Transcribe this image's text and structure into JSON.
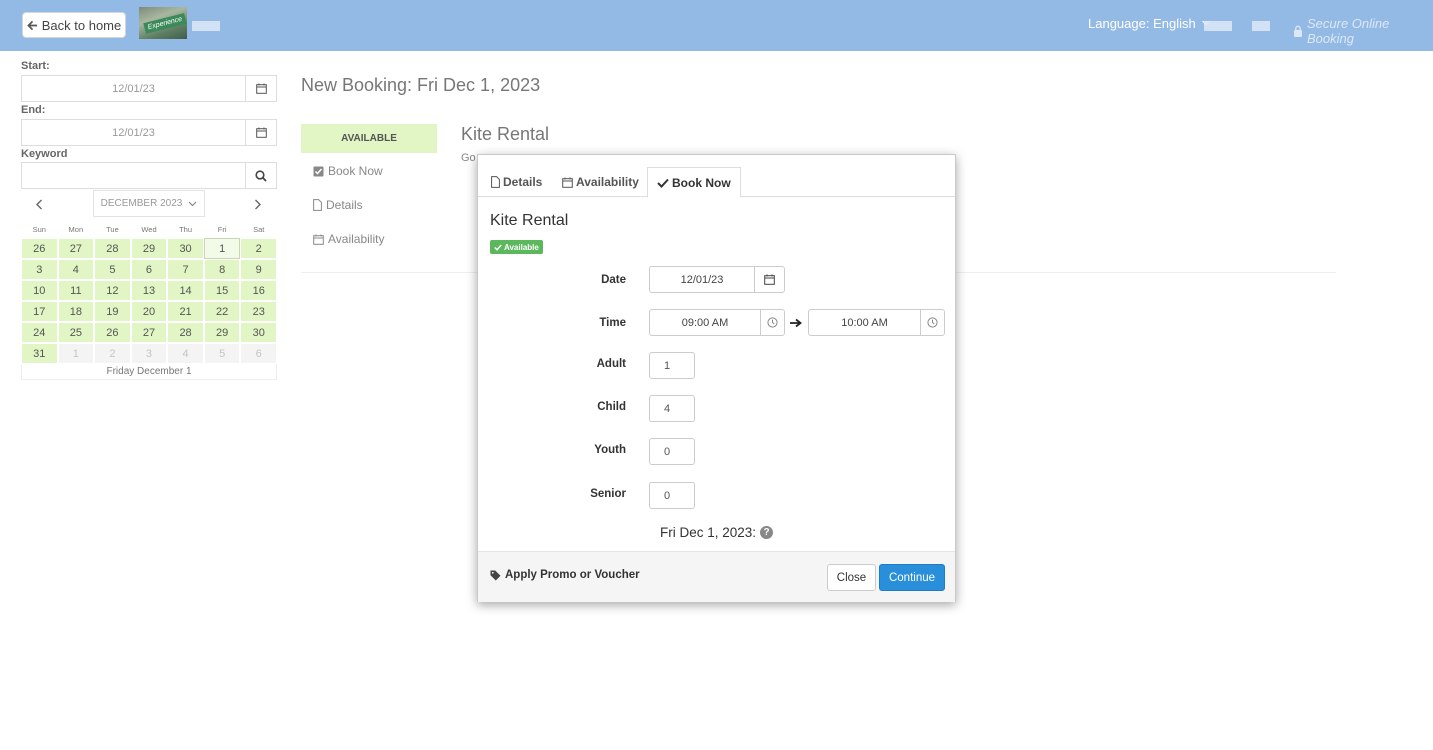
{
  "header": {
    "back_label": "Back to home",
    "logo_text": "Experience",
    "language_label": "Language: English",
    "secure_label": "Secure Online Booking"
  },
  "filters": {
    "start_label": "Start:",
    "start_value": "12/01/23",
    "end_label": "End:",
    "end_value": "12/01/23",
    "keyword_label": "Keyword",
    "keyword_value": ""
  },
  "calendar": {
    "month_label": "DECEMBER 2023",
    "weekdays": [
      "Sun",
      "Mon",
      "Tue",
      "Wed",
      "Thu",
      "Fri",
      "Sat"
    ],
    "days": [
      {
        "d": "26",
        "state": "available"
      },
      {
        "d": "27",
        "state": "available"
      },
      {
        "d": "28",
        "state": "available"
      },
      {
        "d": "29",
        "state": "available"
      },
      {
        "d": "30",
        "state": "available"
      },
      {
        "d": "1",
        "state": "selected"
      },
      {
        "d": "2",
        "state": "available"
      },
      {
        "d": "3",
        "state": "available"
      },
      {
        "d": "4",
        "state": "available"
      },
      {
        "d": "5",
        "state": "available"
      },
      {
        "d": "6",
        "state": "available"
      },
      {
        "d": "7",
        "state": "available"
      },
      {
        "d": "8",
        "state": "available"
      },
      {
        "d": "9",
        "state": "available"
      },
      {
        "d": "10",
        "state": "available"
      },
      {
        "d": "11",
        "state": "available"
      },
      {
        "d": "12",
        "state": "available"
      },
      {
        "d": "13",
        "state": "available"
      },
      {
        "d": "14",
        "state": "available"
      },
      {
        "d": "15",
        "state": "available"
      },
      {
        "d": "16",
        "state": "available"
      },
      {
        "d": "17",
        "state": "available"
      },
      {
        "d": "18",
        "state": "available"
      },
      {
        "d": "19",
        "state": "available"
      },
      {
        "d": "20",
        "state": "available"
      },
      {
        "d": "21",
        "state": "available"
      },
      {
        "d": "22",
        "state": "available"
      },
      {
        "d": "23",
        "state": "available"
      },
      {
        "d": "24",
        "state": "available"
      },
      {
        "d": "25",
        "state": "available"
      },
      {
        "d": "26",
        "state": "available"
      },
      {
        "d": "27",
        "state": "available"
      },
      {
        "d": "28",
        "state": "available"
      },
      {
        "d": "29",
        "state": "available"
      },
      {
        "d": "30",
        "state": "available"
      },
      {
        "d": "31",
        "state": "available"
      },
      {
        "d": "1",
        "state": "other"
      },
      {
        "d": "2",
        "state": "other"
      },
      {
        "d": "3",
        "state": "other"
      },
      {
        "d": "4",
        "state": "other"
      },
      {
        "d": "5",
        "state": "other"
      },
      {
        "d": "6",
        "state": "other"
      }
    ],
    "selected_label": "Friday December 1"
  },
  "main": {
    "page_title": "New Booking: Fri Dec 1, 2023",
    "availability_status": "AVAILABLE",
    "links": {
      "book_now": "Book Now",
      "details": "Details",
      "availability": "Availability"
    },
    "product_title": "Kite Rental",
    "product_desc": "Go"
  },
  "modal": {
    "tabs": {
      "details": "Details",
      "availability": "Availability",
      "book_now": "Book Now"
    },
    "title": "Kite Rental",
    "badge": "Available",
    "date_label": "Date",
    "date_value": "12/01/23",
    "time_label": "Time",
    "time_start": "09:00 AM",
    "time_end": "10:00 AM",
    "adult_label": "Adult",
    "adult_value": "1",
    "child_label": "Child",
    "child_value": "4",
    "youth_label": "Youth",
    "youth_value": "0",
    "senior_label": "Senior",
    "senior_value": "0",
    "summary": "Fri Dec 1, 2023:",
    "promo_label": "Apply Promo or Voucher",
    "close_label": "Close",
    "continue_label": "Continue"
  },
  "colors": {
    "header_bg": "#93b9e5",
    "available_green": "#e1f6c4",
    "badge_green": "#5cb85c",
    "primary_blue": "#2a8fdb"
  }
}
